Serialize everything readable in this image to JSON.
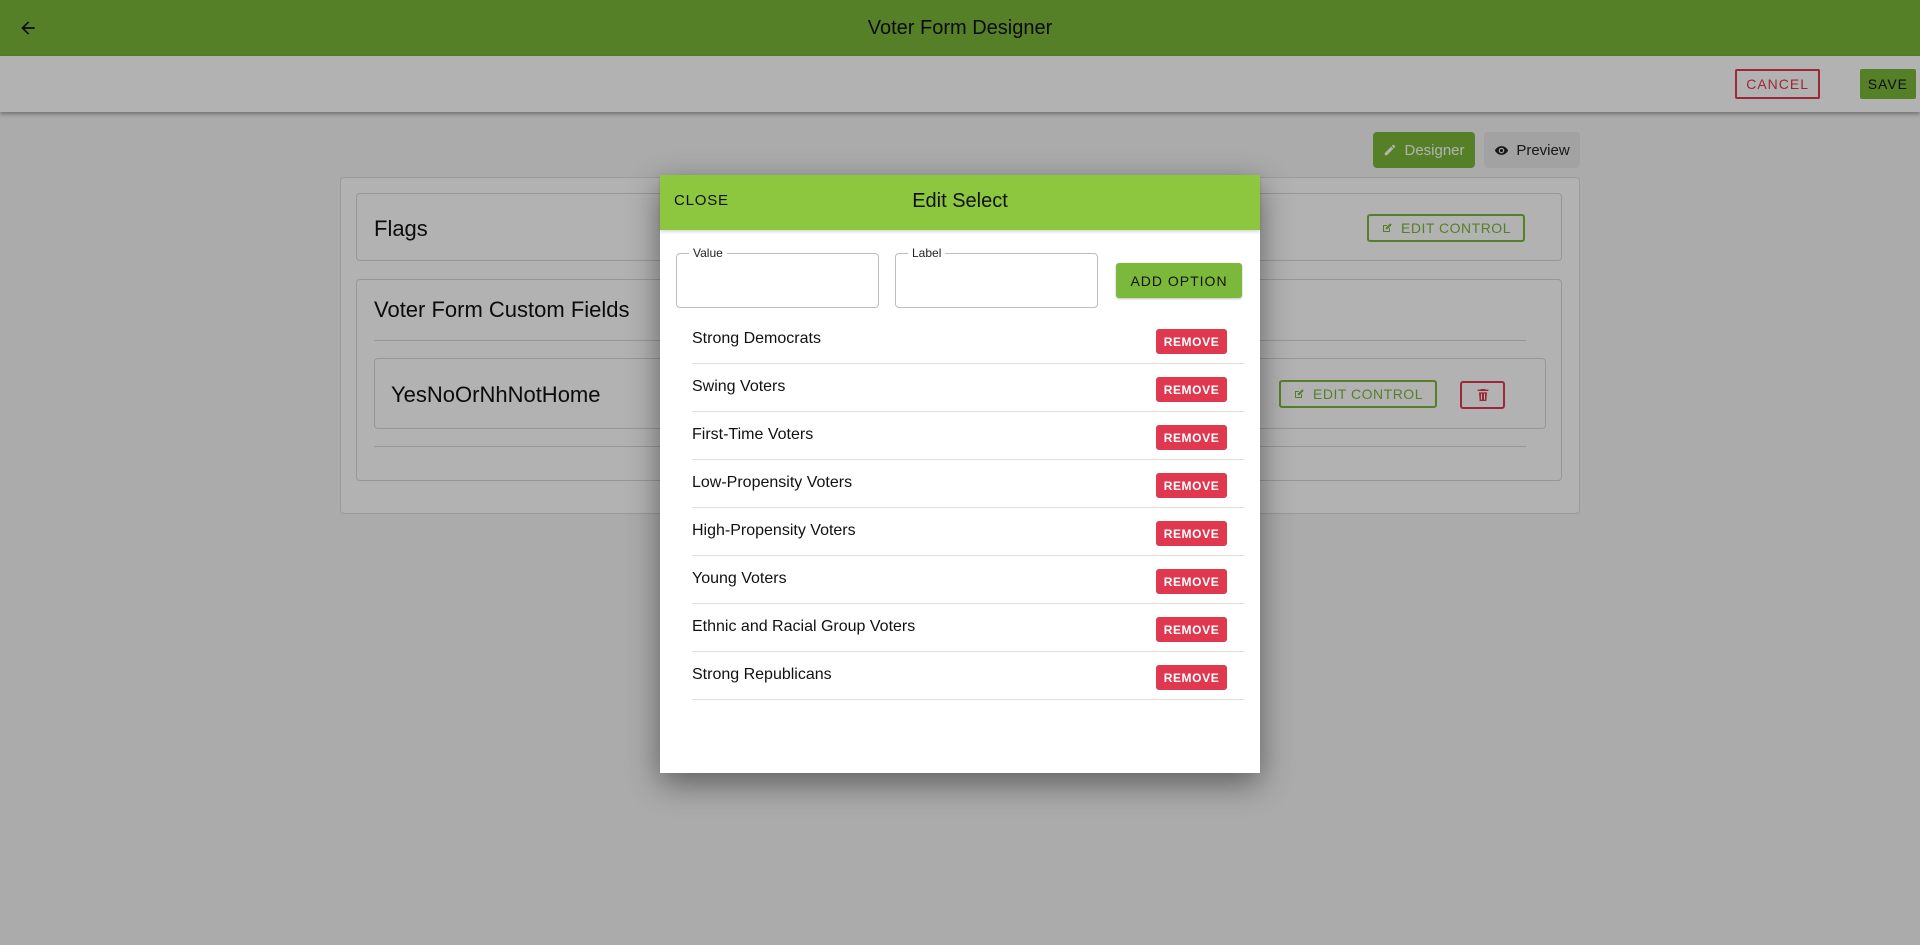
{
  "appbar": {
    "title": "Voter Form Designer",
    "back_icon": "arrow-left-icon"
  },
  "toolbar": {
    "cancel_label": "CANCEL",
    "save_label": "SAVE"
  },
  "mode": {
    "designer_label": "Designer",
    "preview_label": "Preview",
    "active": "Designer"
  },
  "form": {
    "flags_title": "Flags",
    "custom_fields_title": "Voter Form Custom Fields",
    "control_name": "YesNoOrNhNotHome",
    "edit_control_label": "EDIT CONTROL"
  },
  "modal": {
    "close_label": "CLOSE",
    "title": "Edit Select",
    "value_label": "Value",
    "value_value": "",
    "label_label": "Label",
    "label_value": "",
    "add_option_label": "ADD OPTION",
    "remove_label": "REMOVE",
    "options": [
      "Strong Democrats",
      "Swing Voters",
      "First-Time Voters",
      "Low-Propensity Voters",
      "High-Propensity Voters",
      "Young Voters",
      "Ethnic and Racial Group Voters",
      "Strong Republicans"
    ]
  },
  "colors": {
    "brand_green": "#7cb83a",
    "modal_header_green": "#8dc63f",
    "danger_red": "#e0394f"
  }
}
